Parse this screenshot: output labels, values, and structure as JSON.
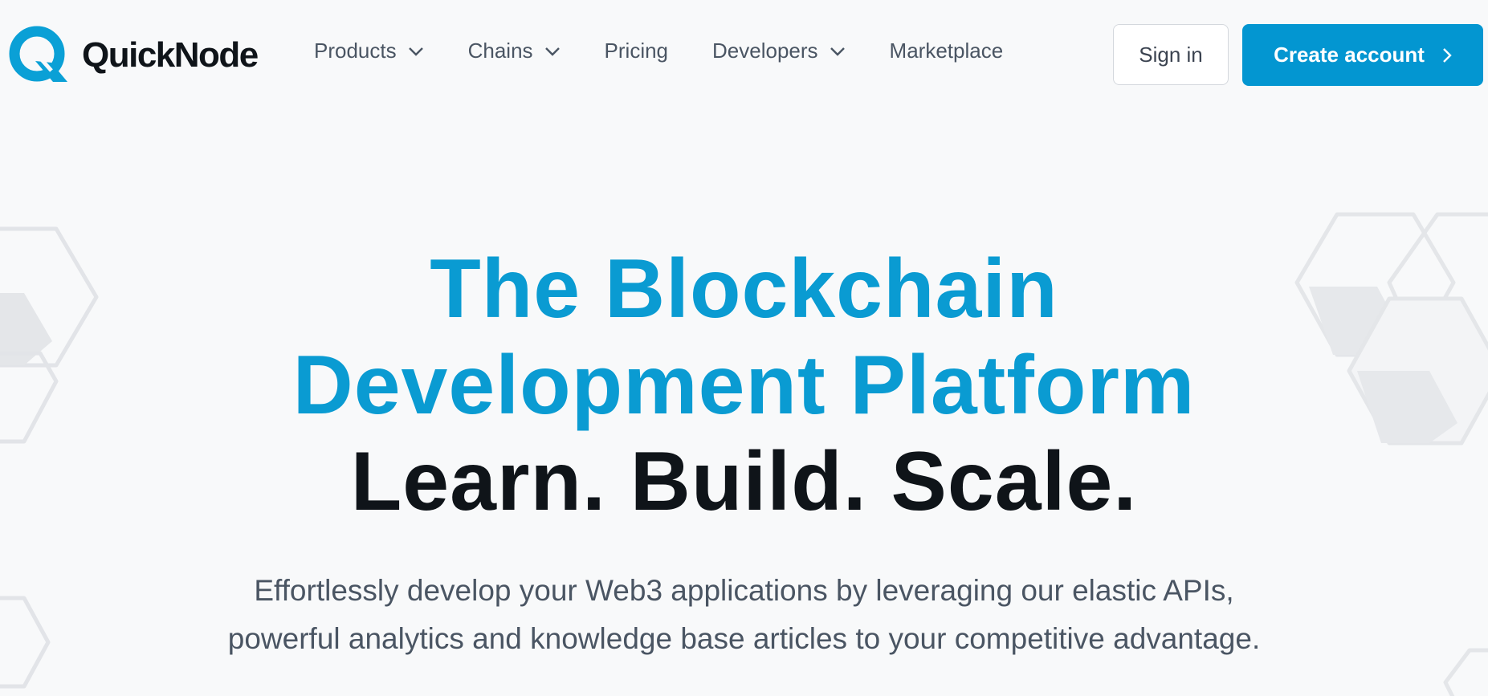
{
  "brand": {
    "name": "QuickNode",
    "accent_color": "#0396d1"
  },
  "nav": {
    "items": [
      {
        "label": "Products",
        "has_dropdown": true
      },
      {
        "label": "Chains",
        "has_dropdown": true
      },
      {
        "label": "Pricing",
        "has_dropdown": false
      },
      {
        "label": "Developers",
        "has_dropdown": true
      },
      {
        "label": "Marketplace",
        "has_dropdown": false
      }
    ]
  },
  "auth": {
    "sign_in_label": "Sign in",
    "create_account_label": "Create account"
  },
  "hero": {
    "title_line_1": "The Blockchain",
    "title_line_2": "Development Platform",
    "title_line_3": "Learn. Build. Scale.",
    "subtitle_line_1": "Effortlessly develop your Web3 applications by leveraging our elastic APIs,",
    "subtitle_line_2": "powerful analytics and knowledge base articles to your competitive advantage."
  },
  "colors": {
    "title_blue": "#0a9bd2",
    "title_dark": "#0f1419",
    "body_text": "#4a5563",
    "background": "#f8f9fa"
  },
  "icons": [
    "quicknode-logo-icon",
    "chevron-down-icon",
    "chevron-right-icon",
    "hexagon-decoration-icon"
  ]
}
